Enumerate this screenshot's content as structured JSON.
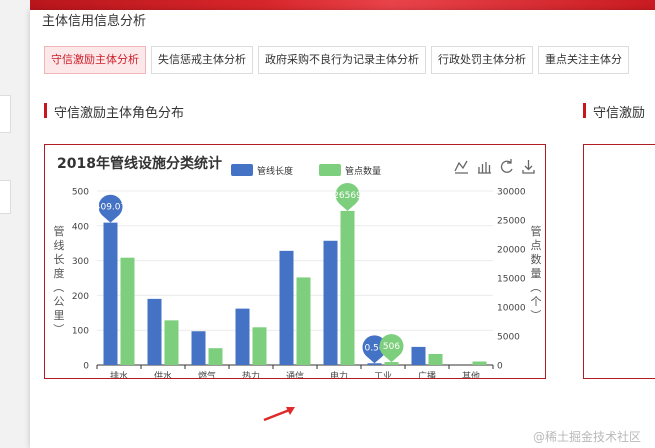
{
  "modal": {
    "title": "主体信用信息分析"
  },
  "tabs": [
    {
      "label": "守信激励主体分析",
      "active": true
    },
    {
      "label": "失信惩戒主体分析",
      "active": false
    },
    {
      "label": "政府采购不良行为记录主体分析",
      "active": false
    },
    {
      "label": "行政处罚主体分析",
      "active": false
    },
    {
      "label": "重点关注主体分",
      "active": false
    }
  ],
  "sections": {
    "left_title": "守信激励主体角色分布",
    "right_title": "守信激励"
  },
  "watermark": "@稀土掘金技术社区",
  "colors": {
    "series1": "#4472c4",
    "series2": "#7dcf7d",
    "accent": "#c8161d"
  },
  "toolbox_icons": [
    "line-chart-icon",
    "bar-chart-icon",
    "refresh-icon",
    "download-icon"
  ],
  "chart_data": {
    "type": "bar",
    "title": "2018年管线设施分类统计",
    "categories": [
      "排水",
      "供水",
      "燃气",
      "热力",
      "通信",
      "电力",
      "工业",
      "广播",
      "其他"
    ],
    "series": [
      {
        "name": "管线长度",
        "axis": "left",
        "values": [
          409.07,
          190,
          97,
          162,
          328,
          357,
          5,
          52,
          0
        ]
      },
      {
        "name": "管点数量",
        "axis": "right",
        "values": [
          18500,
          7700,
          2900,
          6500,
          15100,
          26569,
          506,
          1900,
          600
        ]
      }
    ],
    "ylabel_left": "管线长度（公里）",
    "ylabel_right": "管点数量（个）",
    "ylim_left": [
      0,
      500
    ],
    "ylim_right": [
      0,
      30000
    ],
    "yticks_left": [
      "0",
      "100",
      "200",
      "300",
      "400",
      "500"
    ],
    "yticks_right": [
      "0",
      "5000",
      "10000",
      "15000",
      "20000",
      "25000",
      "30000"
    ],
    "markpoints": [
      {
        "series": 0,
        "category": 0,
        "label": "409.07"
      },
      {
        "series": 0,
        "category": 6,
        "label": "0.56"
      },
      {
        "series": 1,
        "category": 5,
        "label": "26569"
      },
      {
        "series": 1,
        "category": 6,
        "label": "506"
      }
    ],
    "legend_position": "top-center",
    "grid": true
  }
}
